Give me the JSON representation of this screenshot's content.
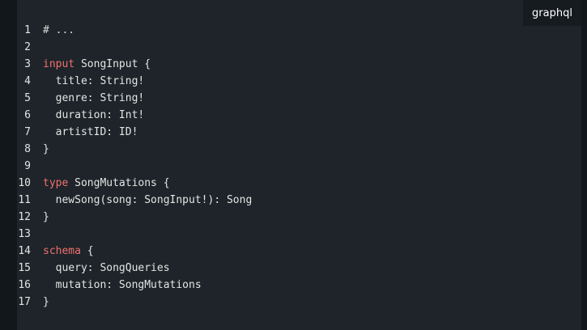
{
  "code_block": {
    "language": "graphql",
    "lines": [
      {
        "number": "1",
        "segments": [
          {
            "text": "# ...",
            "kind": "comment"
          }
        ]
      },
      {
        "number": "2",
        "segments": []
      },
      {
        "number": "3",
        "segments": [
          {
            "text": "input",
            "kind": "keyword"
          },
          {
            "text": " SongInput {",
            "kind": "plain"
          }
        ]
      },
      {
        "number": "4",
        "segments": [
          {
            "text": "  title: String!",
            "kind": "plain"
          }
        ]
      },
      {
        "number": "5",
        "segments": [
          {
            "text": "  genre: String!",
            "kind": "plain"
          }
        ]
      },
      {
        "number": "6",
        "segments": [
          {
            "text": "  duration: Int!",
            "kind": "plain"
          }
        ]
      },
      {
        "number": "7",
        "segments": [
          {
            "text": "  artistID: ID!",
            "kind": "plain"
          }
        ]
      },
      {
        "number": "8",
        "segments": [
          {
            "text": "}",
            "kind": "plain"
          }
        ]
      },
      {
        "number": "9",
        "segments": []
      },
      {
        "number": "10",
        "segments": [
          {
            "text": "type",
            "kind": "keyword"
          },
          {
            "text": " SongMutations {",
            "kind": "plain"
          }
        ]
      },
      {
        "number": "11",
        "segments": [
          {
            "text": "  newSong(song: SongInput!): Song",
            "kind": "plain"
          }
        ]
      },
      {
        "number": "12",
        "segments": [
          {
            "text": "}",
            "kind": "plain"
          }
        ]
      },
      {
        "number": "13",
        "segments": []
      },
      {
        "number": "14",
        "segments": [
          {
            "text": "schema",
            "kind": "keyword"
          },
          {
            "text": " {",
            "kind": "plain"
          }
        ]
      },
      {
        "number": "15",
        "segments": [
          {
            "text": "  query: SongQueries",
            "kind": "plain"
          }
        ]
      },
      {
        "number": "16",
        "segments": [
          {
            "text": "  mutation: SongMutations",
            "kind": "plain"
          }
        ]
      },
      {
        "number": "17",
        "segments": [
          {
            "text": "}",
            "kind": "plain"
          }
        ]
      }
    ]
  },
  "colors": {
    "page_background": "#12171c",
    "code_background": "#1e2429",
    "badge_background": "#161b20",
    "text": "#e4e4e4",
    "keyword": "#f07070"
  }
}
